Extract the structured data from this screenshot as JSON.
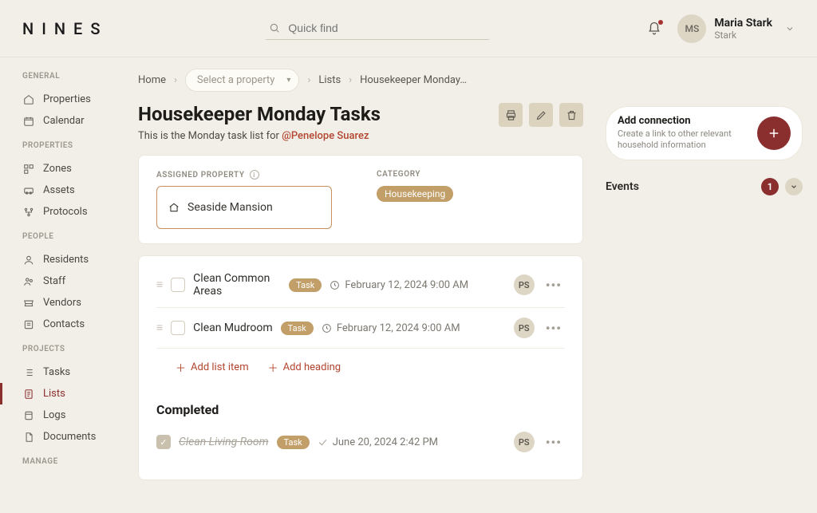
{
  "header": {
    "logo": "NINES",
    "search_placeholder": "Quick find",
    "user": {
      "initials": "MS",
      "name": "Maria Stark",
      "sub": "Stark"
    }
  },
  "sidebar": {
    "sections": [
      {
        "title": "GENERAL",
        "items": [
          {
            "label": "Properties"
          },
          {
            "label": "Calendar"
          }
        ]
      },
      {
        "title": "PROPERTIES",
        "items": [
          {
            "label": "Zones"
          },
          {
            "label": "Assets"
          },
          {
            "label": "Protocols"
          }
        ]
      },
      {
        "title": "PEOPLE",
        "items": [
          {
            "label": "Residents"
          },
          {
            "label": "Staff"
          },
          {
            "label": "Vendors"
          },
          {
            "label": "Contacts"
          }
        ]
      },
      {
        "title": "PROJECTS",
        "items": [
          {
            "label": "Tasks"
          },
          {
            "label": "Lists"
          },
          {
            "label": "Logs"
          },
          {
            "label": "Documents"
          }
        ]
      },
      {
        "title": "MANAGE",
        "items": []
      }
    ]
  },
  "breadcrumb": {
    "home": "Home",
    "property_select": "Select a property",
    "lists": "Lists",
    "current": "Housekeeper Monday…"
  },
  "page": {
    "title": "Housekeeper Monday Tasks",
    "subtitle_pre": "This is the Monday task list for ",
    "mention": "@Penelope Suarez"
  },
  "meta": {
    "assigned_label": "ASSIGNED PROPERTY",
    "property_name": "Seaside Mansion",
    "category_label": "CATEGORY",
    "category_value": "Housekeeping"
  },
  "tasks": [
    {
      "title": "Clean Common Areas",
      "tag": "Task",
      "date": "February 12, 2024 9:00 AM",
      "assignee": "PS"
    },
    {
      "title": "Clean Mudroom",
      "tag": "Task",
      "date": "February 12, 2024 9:00 AM",
      "assignee": "PS"
    }
  ],
  "add": {
    "item": "Add list item",
    "heading": "Add heading"
  },
  "completed": {
    "heading": "Completed",
    "tasks": [
      {
        "title": "Clean Living Room",
        "tag": "Task",
        "date": "June 20, 2024 2:42 PM",
        "assignee": "PS"
      }
    ]
  },
  "right": {
    "connection": {
      "title": "Add connection",
      "sub": "Create a link to other relevant household information"
    },
    "events": {
      "label": "Events",
      "count": "1"
    }
  }
}
